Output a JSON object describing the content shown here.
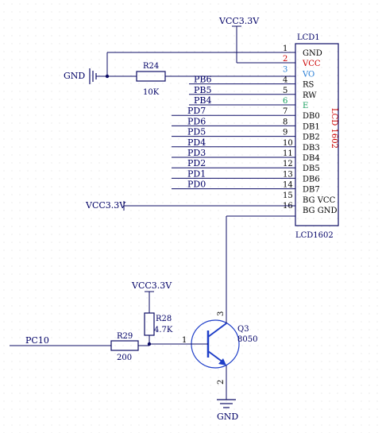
{
  "colors": {
    "wire": "#0d0d66",
    "body": "#0d0d66",
    "text": "#000066",
    "vcc_pin": "#cc0000",
    "vo_pin": "#2a7fd6",
    "e_pin": "#139c5b",
    "transistor": "#1f3fc8"
  },
  "lcd": {
    "designator": "LCD1",
    "part_name": "LCD1602",
    "value_vertical": "LCD 1602",
    "pins": [
      {
        "num": "1",
        "name": "GND",
        "net": ""
      },
      {
        "num": "2",
        "name": "VCC",
        "net": ""
      },
      {
        "num": "3",
        "name": "VO",
        "net": ""
      },
      {
        "num": "4",
        "name": "RS",
        "net": "PB6"
      },
      {
        "num": "5",
        "name": "RW",
        "net": "PB5"
      },
      {
        "num": "6",
        "name": "E",
        "net": "PB4"
      },
      {
        "num": "7",
        "name": "DB0",
        "net": "PD7"
      },
      {
        "num": "8",
        "name": "DB1",
        "net": "PD6"
      },
      {
        "num": "9",
        "name": "DB2",
        "net": "PD5"
      },
      {
        "num": "10",
        "name": "DB3",
        "net": "PD4"
      },
      {
        "num": "11",
        "name": "DB4",
        "net": "PD3"
      },
      {
        "num": "12",
        "name": "DB5",
        "net": "PD2"
      },
      {
        "num": "13",
        "name": "DB6",
        "net": "PD1"
      },
      {
        "num": "14",
        "name": "DB7",
        "net": "PD0"
      },
      {
        "num": "15",
        "name": "BG VCC",
        "net": ""
      },
      {
        "num": "16",
        "name": "BG GND",
        "net": ""
      }
    ]
  },
  "nets": {
    "vcc_top": "VCC3.3V",
    "gnd_left": "GND",
    "vcc_bg": "VCC3.3V",
    "vcc_r28": "VCC3.3V",
    "gnd_bottom": "GND",
    "pc10": "PC10"
  },
  "r24": {
    "designator": "R24",
    "value": "10K"
  },
  "r28": {
    "designator": "R28",
    "value": "4.7K"
  },
  "r29": {
    "designator": "R29",
    "value": "200"
  },
  "q3": {
    "designator": "Q3",
    "value": "8050",
    "pin_base": "1",
    "pin_emitter": "2",
    "pin_collector": "3"
  }
}
